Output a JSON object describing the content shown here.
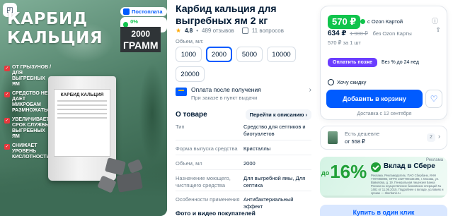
{
  "gallery": {
    "title_line1": "КАРБИД",
    "title_line2": "КАЛЬЦИЯ",
    "gram_value": "2000",
    "gram_unit": "ГРАММ",
    "badge_postoplata": "Постоплата",
    "badge_return": "0% возвратов",
    "features": [
      "от грызунов / для выгребных ям",
      "средство не дает микробам размножаться",
      "увеличивает срок службы выгребных ям",
      "снижает уровень кислотности"
    ],
    "bag_label": "КАРБИД КАЛЬЦИЯ"
  },
  "product": {
    "title": "Карбид кальция для выгребных ям 2 кг",
    "rating": "4.8",
    "reviews": "489 отзывов",
    "questions": "11 вопросов",
    "volume_label": "Объем, мл:",
    "volumes": [
      "1000",
      "2000",
      "5000",
      "10000",
      "20000"
    ],
    "selected_volume": "2000",
    "payment_title": "Оплата после получения",
    "payment_sub": "При заказе в пункт выдачи"
  },
  "about": {
    "heading": "О товаре",
    "link": "Перейти к описанию",
    "specs": [
      {
        "key": "Тип",
        "value": "Средство для септиков и биотуалетов"
      },
      {
        "key": "Форма выпуска средства",
        "value": "Кристаллы"
      },
      {
        "key": "Объем, мл",
        "value": "2000"
      },
      {
        "key": "Назначение моющего, чистящего средства",
        "value": "Для выгребной ямы, Для септика"
      },
      {
        "key": "Особенности применения",
        "value": "Антибактериальный эффект"
      }
    ],
    "photos_heading": "Фото и видео покупателей"
  },
  "buybox": {
    "card_price": "570 ₽",
    "card_label": "с Ozon Картой",
    "price": "634 ₽",
    "old_price": "1 900 ₽",
    "price_label": "без Ozon Карты",
    "per_unit": "570 ₽ за 1 шт",
    "pay_later_button": "Оплатить позже",
    "pay_later_text": "Без % до 24 нед",
    "want_discount": "Хочу скидку",
    "add_to_cart": "Добавить в корзину",
    "delivery": "Доставка с 12 сентября"
  },
  "cheaper": {
    "title": "Есть дешевле",
    "price": "от 558 ₽",
    "count": "2"
  },
  "sber_ad": {
    "percent": "16%",
    "percent_prefix": "до",
    "heading": "Вклад в Сбере",
    "ad_label": "Реклама",
    "legal": "Реклама. Рекламодатель: ПАО Сбербанк, ИНН 7707083893, ОГРН 1027700132195, г. Москва, ул. Вавилова, д. 19. Генеральная лицензия Банка России на осуществление банковских операций № 1481 от 11.08.2015. Подробнее о вкладе, условиях и сроках — sberbank.ru"
  },
  "buy_one_click": "Купить в один клик",
  "colors": {
    "accent": "#005bff",
    "green_price": "#10c44c",
    "pay_later": "#6b3dff",
    "sber_green": "#21a038"
  }
}
